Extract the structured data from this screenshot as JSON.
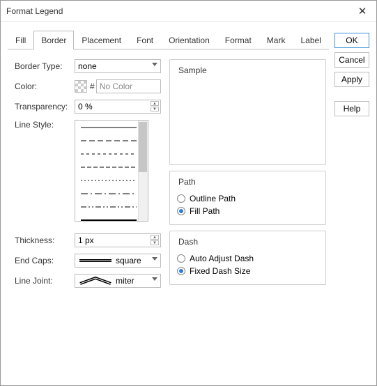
{
  "title": "Format Legend",
  "buttons": {
    "ok": "OK",
    "cancel": "Cancel",
    "apply": "Apply",
    "help": "Help"
  },
  "tabs": [
    "Fill",
    "Border",
    "Placement",
    "Font",
    "Orientation",
    "Format",
    "Mark",
    "Label"
  ],
  "active_tab": 1,
  "labels": {
    "border_type": "Border Type:",
    "color": "Color:",
    "transparency": "Transparency:",
    "line_style": "Line Style:",
    "thickness": "Thickness:",
    "end_caps": "End Caps:",
    "line_joint": "Line Joint:"
  },
  "border_type_value": "none",
  "color_value": "No Color",
  "transparency_value": "0 %",
  "thickness_value": "1 px",
  "end_caps_value": "square",
  "line_joint_value": "miter",
  "groups": {
    "sample": "Sample",
    "path": "Path",
    "dash": "Dash"
  },
  "path": {
    "outline": "Outline Path",
    "fill": "Fill Path",
    "selected": "fill"
  },
  "dash": {
    "auto": "Auto Adjust Dash",
    "fixed": "Fixed Dash Size",
    "selected": "fixed"
  }
}
